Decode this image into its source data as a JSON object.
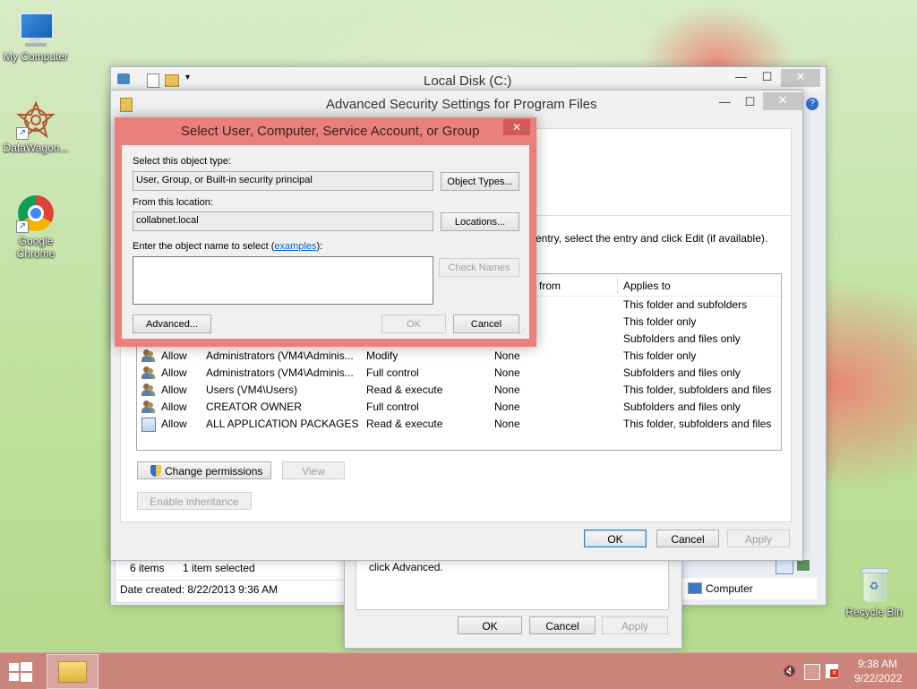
{
  "desktop": {
    "icons": [
      {
        "label": "My Computer"
      },
      {
        "label": "DataWagon..."
      },
      {
        "label": "Google Chrome"
      },
      {
        "label": "Recycle Bin"
      }
    ]
  },
  "explorer": {
    "title": "Local Disk (C:)",
    "status_items": "6 items",
    "status_selected": "1 item selected",
    "date_created": "Date created: 8/22/2013 9:36 AM",
    "computer_label": "Computer"
  },
  "props_dialog": {
    "text": "click Advanced.",
    "ok": "OK",
    "cancel": "Cancel",
    "apply": "Apply"
  },
  "adv_security": {
    "title": "Advanced Security Settings for Program Files",
    "instruction": "entry, select the entry and click Edit (if available).",
    "col_from": "from",
    "col_applies": "Applies to",
    "upper_applies": [
      "This folder and subfolders",
      "This folder only",
      "Subfolders and files only"
    ],
    "rows": [
      {
        "type": "Allow",
        "principal": "Administrators (VM4\\Adminis...",
        "access": "Modify",
        "inherited": "None",
        "applies": "This folder only"
      },
      {
        "type": "Allow",
        "principal": "Administrators (VM4\\Adminis...",
        "access": "Full control",
        "inherited": "None",
        "applies": "Subfolders and files only"
      },
      {
        "type": "Allow",
        "principal": "Users (VM4\\Users)",
        "access": "Read & execute",
        "inherited": "None",
        "applies": "This folder, subfolders and files"
      },
      {
        "type": "Allow",
        "principal": "CREATOR OWNER",
        "access": "Full control",
        "inherited": "None",
        "applies": "Subfolders and files only"
      },
      {
        "type": "Allow",
        "principal": "ALL APPLICATION PACKAGES",
        "access": "Read & execute",
        "inherited": "None",
        "applies": "This folder, subfolders and files"
      }
    ],
    "change_permissions": "Change permissions",
    "view": "View",
    "enable_inheritance": "Enable inheritance",
    "ok": "OK",
    "cancel": "Cancel",
    "apply": "Apply"
  },
  "select_dialog": {
    "title": "Select User, Computer, Service Account, or Group",
    "object_type_label": "Select this object type:",
    "object_type_value": "User, Group, or Built-in security principal",
    "object_types_button": "Object Types...",
    "location_label": "From this location:",
    "location_value": "collabnet.local",
    "locations_button": "Locations...",
    "name_label_prefix": "Enter the object name to select (",
    "name_label_link": "examples",
    "name_label_suffix": "):",
    "name_value": "",
    "check_names": "Check Names",
    "advanced": "Advanced...",
    "ok": "OK",
    "cancel": "Cancel"
  },
  "taskbar": {
    "time": "9:38 AM",
    "date": "9/22/2022"
  },
  "colors": {
    "dialog_frame": "#e9807b",
    "taskbar": "#cd7d78",
    "link": "#0066cc"
  }
}
